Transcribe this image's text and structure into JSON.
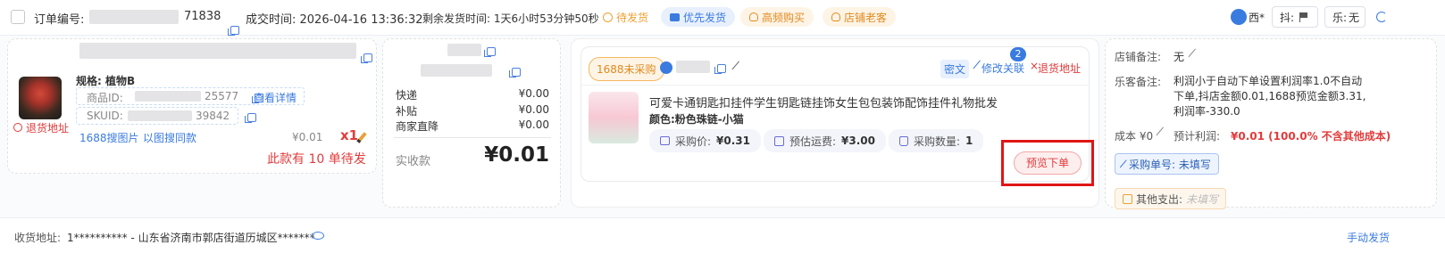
{
  "header": {
    "order_no_label": "订单编号:",
    "order_no_suffix": "71838",
    "deal_time": "成交时间: 2026-04-16 13:36:32",
    "remain_time": "剩余发货时间: 1天6小时53分钟50秒",
    "tags": [
      "待发货",
      "优先发货",
      "高频购买",
      "店铺老客"
    ],
    "user_name": "西*",
    "douyin_label": "抖:",
    "le_label": "乐:",
    "le_value": "无"
  },
  "product": {
    "spec": "规格: 植物B",
    "goods_id_label": "商品ID:",
    "goods_id_suffix": "25577",
    "view_detail": "查看详情",
    "sku_label": "SKUID:",
    "sku_suffix": "39842",
    "return_addr": "退货地址",
    "search_1688": "1688搜图片",
    "search_same": "以图搜同款",
    "price": "¥0.01",
    "qty": "x1",
    "pending": "此款有 10 单待发"
  },
  "fees": {
    "rows": [
      {
        "label": "快递",
        "value": "¥0.00"
      },
      {
        "label": "补贴",
        "value": "¥0.00"
      },
      {
        "label": "商家直降",
        "value": "¥0.00"
      }
    ],
    "actual_label": "实收款",
    "actual_value": "¥0.01"
  },
  "purchase": {
    "status": "1688未采购",
    "badge_count": "2",
    "cipher": "密文",
    "modify_link": "修改关联",
    "return_addr": "退货地址",
    "title": "可爱卡通钥匙扣挂件学生钥匙链挂饰女生包包装饰配饰挂件礼物批发",
    "color": "颜色:粉色珠链-小猫",
    "buy_price_label": "采购价:",
    "buy_price": "¥0.31",
    "freight_label": "预估运费:",
    "freight": "¥3.00",
    "qty_label": "采购数量:",
    "qty": "1",
    "preview_btn": "预览下单"
  },
  "remarks": {
    "shop_label": "店铺备注:",
    "shop_value": "无",
    "le_label": "乐客备注:",
    "le_value": "利润小于自动下单设置利润率1.0不自动下单,抖店金额0.01,1688预览金额3.31,利润率-330.0",
    "cost": "成本 ¥0",
    "profit_label": "预计利润:",
    "profit_value": "¥0.01 (100.0% 不含其他成本)",
    "purchase_no": "采购单号: 未填写",
    "other_label": "其他支出:",
    "other_value": "未填写"
  },
  "footer": {
    "address_label": "收货地址:",
    "address": "1********** - 山东省济南市郭店街道历城区*******",
    "manual_ship": "手动发货"
  },
  "colors": {
    "accent": "#3a7be0",
    "danger": "#e23b3b",
    "orange": "#f0a032"
  }
}
